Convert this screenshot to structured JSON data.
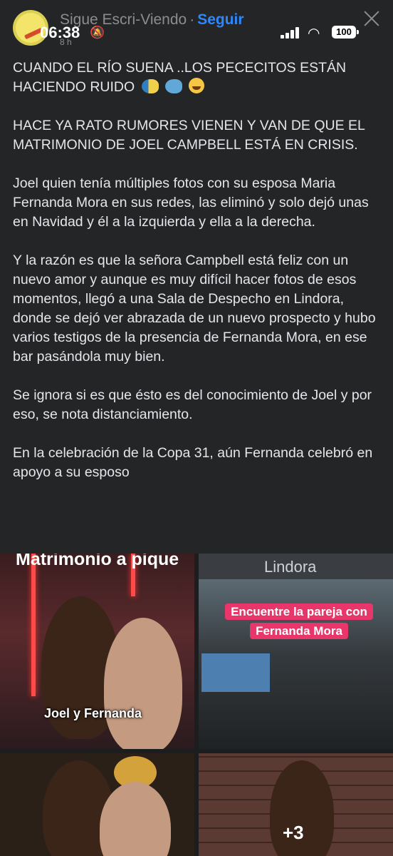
{
  "header": {
    "page_name": "Sigue Escri-Viendo",
    "separator": "·",
    "follow_label": "Seguir",
    "subtime": "8 h"
  },
  "status_bar": {
    "time": "06:38",
    "battery": "100"
  },
  "post": {
    "paragraphs": [
      "CUANDO EL RÍO SUENA ..LOS PECECITOS ESTÁN HACIENDO RUIDO",
      "HACE YA RATO RUMORES VIENEN Y VAN DE QUE EL MATRIMONIO DE JOEL CAMPBELL ESTÁ EN CRISIS.",
      "Joel quien tenía múltiples fotos con su esposa Maria Fernanda Mora en sus redes, las eliminó y solo dejó unas en Navidad y él a la izquierda y ella a la derecha.",
      "Y la razón es que la señora Campbell está feliz con un nuevo amor y aunque es muy difícil hacer fotos de esos momentos, llegó a una Sala de Despecho en Lindora, donde se dejó ver abrazada de un nuevo prospecto y hubo varios testigos de la presencia de Fernanda Mora, en ese bar pasándola muy bien.",
      "Se ignora si es que ésto es del conocimiento de Joel y por eso, se nota distanciamiento.",
      "En la celebración de la Copa 31, aún Fernanda celebró en apoyo a su esposo"
    ]
  },
  "photos": {
    "photo1_title": "Matrimonio a pique",
    "photo1_caption": "Joel y Fernanda",
    "photo2_title": "Lindora",
    "photo2_line1": "Encuentre la pareja con",
    "photo2_line2": "Fernanda Mora",
    "more_count": "+3"
  }
}
